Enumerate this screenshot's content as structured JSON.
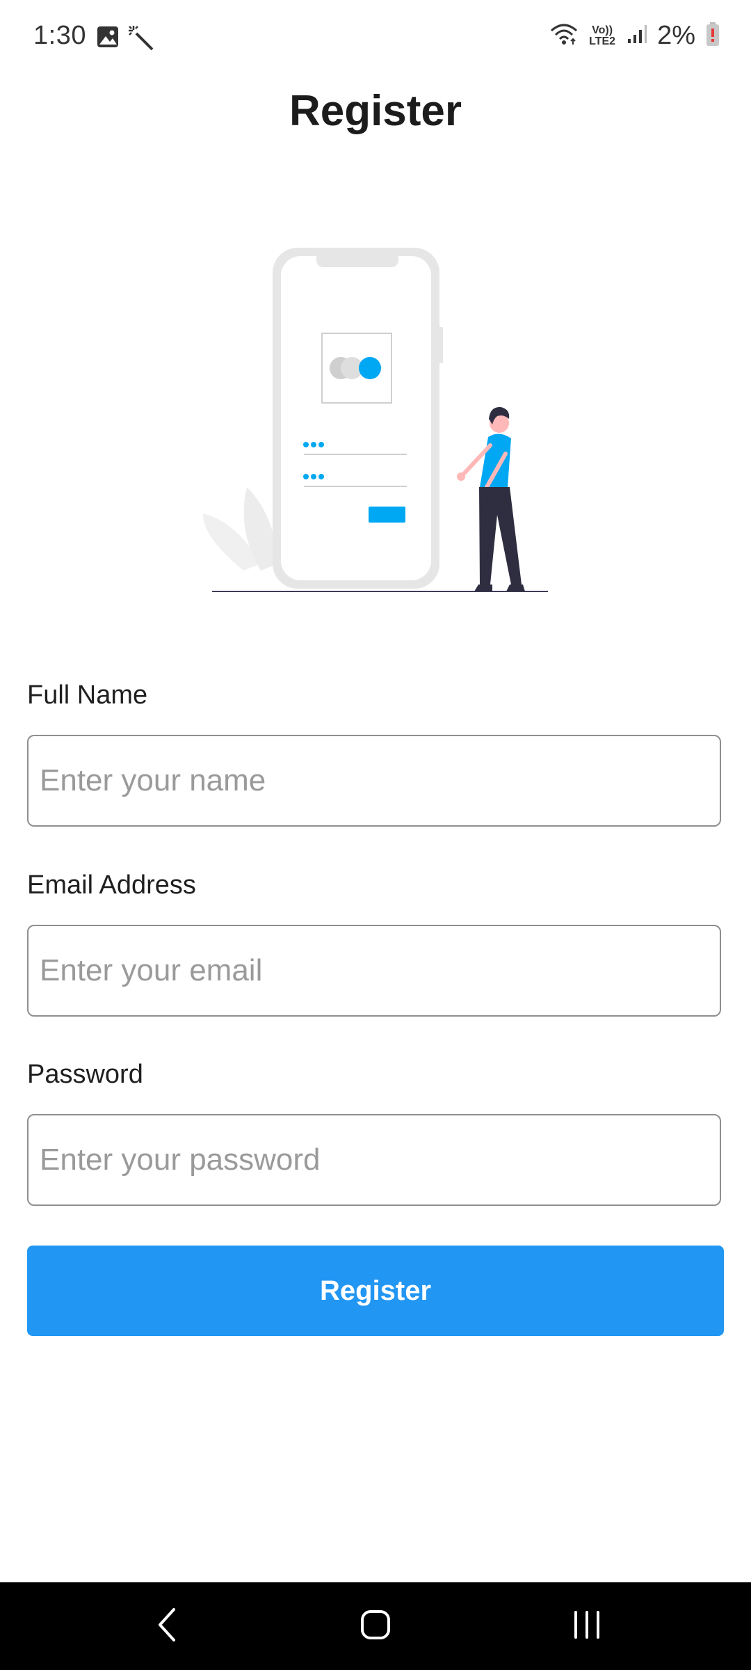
{
  "status_bar": {
    "time": "1:30",
    "battery_percent": "2%",
    "network_label": "Vo)) LTE2",
    "icons": [
      "image-icon",
      "magic-wand-icon",
      "wifi-icon",
      "signal-icon",
      "battery-low-icon"
    ]
  },
  "page": {
    "title": "Register"
  },
  "form": {
    "name": {
      "label": "Full Name",
      "placeholder": "Enter your name",
      "value": ""
    },
    "email": {
      "label": "Email Address",
      "placeholder": "Enter your email",
      "value": ""
    },
    "password": {
      "label": "Password",
      "placeholder": "Enter your password",
      "value": ""
    },
    "submit_label": "Register"
  },
  "colors": {
    "accent": "#2196f3",
    "illustration_accent": "#00a8f3",
    "nav_background": "#000000"
  },
  "nav_bar": {
    "icons": [
      "back-icon",
      "home-icon",
      "recents-icon"
    ]
  }
}
